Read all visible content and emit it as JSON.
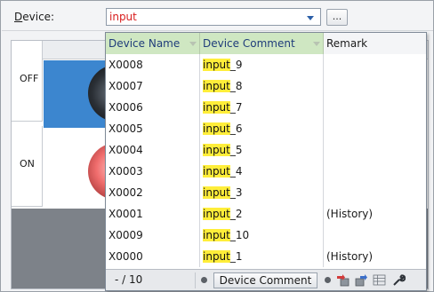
{
  "device": {
    "label": "Device:",
    "label_accel": "D",
    "label_rest": "evice:",
    "value": "input",
    "browse_label": "..."
  },
  "states": {
    "off": "OFF",
    "on": "ON"
  },
  "list": {
    "columns": [
      "Device Name",
      "Device Comment",
      "Remark"
    ],
    "highlight_color": "#ffee3a",
    "rows": [
      {
        "name": "X0008",
        "hl": "input",
        "rest": "_9",
        "remark": ""
      },
      {
        "name": "X0007",
        "hl": "input",
        "rest": "_8",
        "remark": ""
      },
      {
        "name": "X0006",
        "hl": "input",
        "rest": "_7",
        "remark": ""
      },
      {
        "name": "X0005",
        "hl": "input",
        "rest": "_6",
        "remark": ""
      },
      {
        "name": "X0004",
        "hl": "input",
        "rest": "_5",
        "remark": ""
      },
      {
        "name": "X0003",
        "hl": "input",
        "rest": "_4",
        "remark": ""
      },
      {
        "name": "X0002",
        "hl": "input",
        "rest": "_3",
        "remark": ""
      },
      {
        "name": "X0001",
        "hl": "input",
        "rest": "_2",
        "remark": "(History)"
      },
      {
        "name": "X0009",
        "hl": "input",
        "rest": "_10",
        "remark": ""
      },
      {
        "name": "X0000",
        "hl": "input",
        "rest": "_1",
        "remark": "(History)"
      }
    ],
    "footer": {
      "count": "- / 10",
      "mode_button": "Device Comment",
      "icons": [
        "import-icon",
        "export-icon",
        "table-icon",
        "wrench-icon"
      ]
    }
  }
}
